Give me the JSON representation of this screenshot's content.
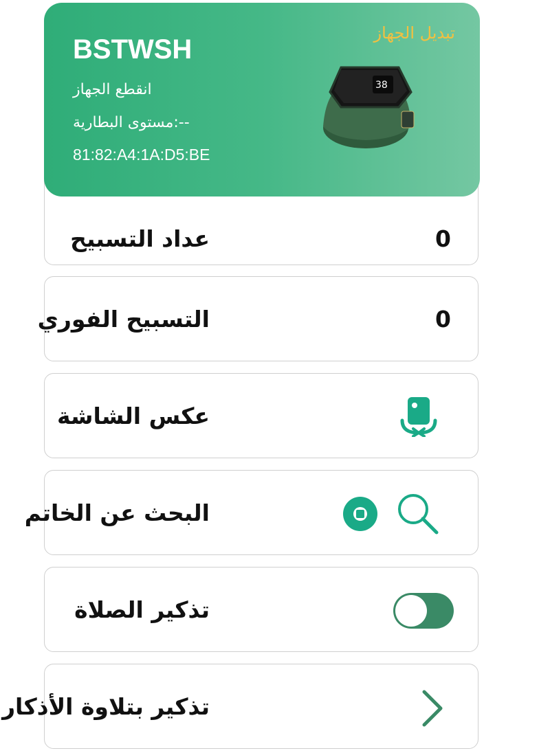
{
  "device": {
    "name": "BSTWSH",
    "status": "انقطع الجهاز",
    "battery": "مستوى البطارية:--",
    "mac": "81:82:A4:1A:D5:BE",
    "switch_label": "تبديل الجهاز"
  },
  "rows": [
    {
      "label": "عداد التسبيح",
      "count": "0"
    },
    {
      "label": "التسبيح الفوري",
      "count": "0"
    },
    {
      "label": "عكس الشاشة",
      "icon": "screen-rotate-icon"
    },
    {
      "label": "البحث عن الخاتم",
      "icon": "search-icon"
    },
    {
      "label": "تذكير الصلاة",
      "toggle": "off"
    },
    {
      "label": "تذكير بتلاوة الأذكار",
      "icon": "chevron-right-icon"
    }
  ],
  "colors": {
    "accent": "#2fad78",
    "icon": "#1aaa87",
    "toggle": "#3a8a66"
  }
}
